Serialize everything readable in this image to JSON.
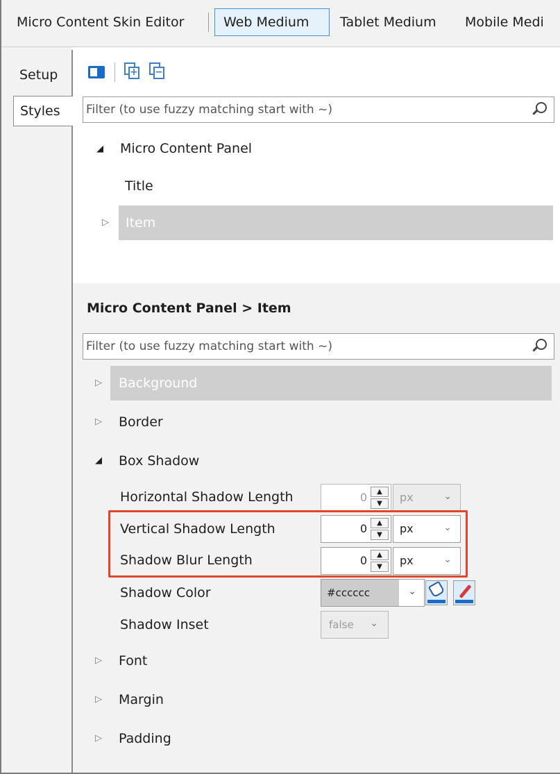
{
  "top_tabs": {
    "skin_editor": "Micro Content Skin Editor",
    "web": "Web Medium",
    "tablet": "Tablet Medium",
    "mobile": "Mobile Medi"
  },
  "side_tabs": {
    "setup": "Setup",
    "styles": "Styles"
  },
  "toolbar": {
    "icons": [
      "panel-icon",
      "expand-all-icon",
      "collapse-all-icon"
    ]
  },
  "filter_top": {
    "placeholder": "Filter (to use fuzzy matching start with ~)"
  },
  "tree": {
    "root": "Micro Content Panel",
    "children": [
      "Title",
      "Item"
    ],
    "selected": "Item"
  },
  "properties": {
    "heading": "Micro Content Panel > Item",
    "filter_placeholder": "Filter (to use fuzzy matching start with ~)",
    "categories": {
      "background": "Background",
      "border": "Border",
      "box_shadow": "Box Shadow",
      "font": "Font",
      "margin": "Margin",
      "padding": "Padding"
    },
    "box_shadow": {
      "horizontal": {
        "label": "Horizontal Shadow Length",
        "value": "0",
        "unit": "px"
      },
      "vertical": {
        "label": "Vertical Shadow Length",
        "value": "0",
        "unit": "px"
      },
      "blur": {
        "label": "Shadow Blur Length",
        "value": "0",
        "unit": "px"
      },
      "color": {
        "label": "Shadow Color",
        "value": "#cccccc"
      },
      "inset": {
        "label": "Shadow Inset",
        "value": "false"
      }
    }
  },
  "colors": {
    "accent": "#1a6cc7",
    "highlight_box": "#e0462e",
    "selection": "#cfcfcf"
  }
}
